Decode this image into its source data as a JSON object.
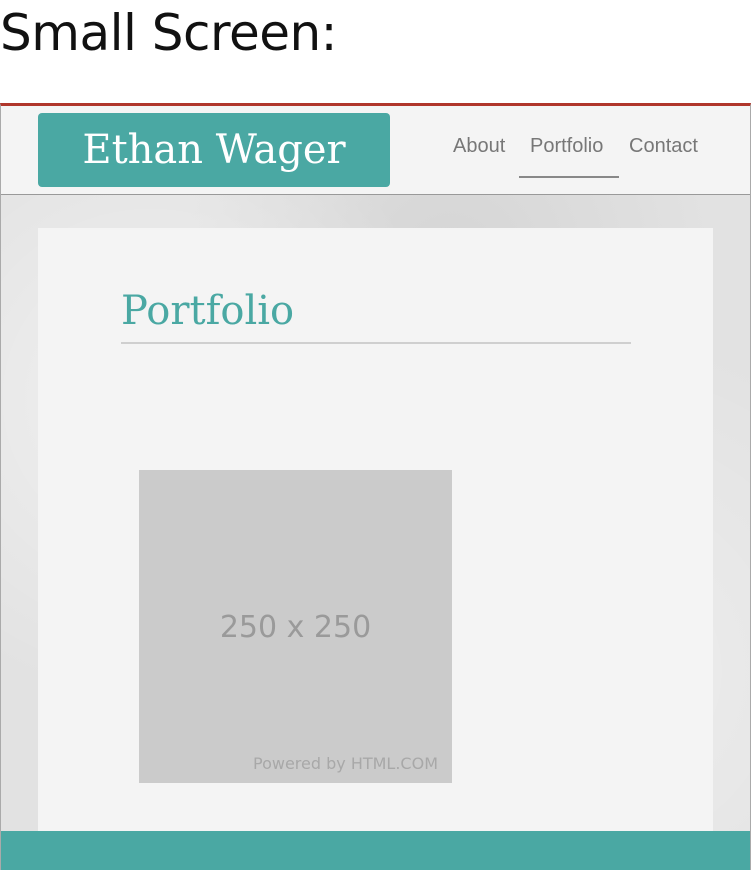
{
  "caption": "Small Screen:",
  "header": {
    "brand": "Ethan Wager",
    "nav": [
      {
        "label": "About"
      },
      {
        "label": "Portfolio"
      },
      {
        "label": "Contact"
      }
    ]
  },
  "main": {
    "title": "Portfolio",
    "placeholder": {
      "size_text": "250 x 250",
      "credit": "Powered by HTML.COM"
    }
  },
  "colors": {
    "accent": "#4aa8a3",
    "top_border": "#b0362b"
  }
}
